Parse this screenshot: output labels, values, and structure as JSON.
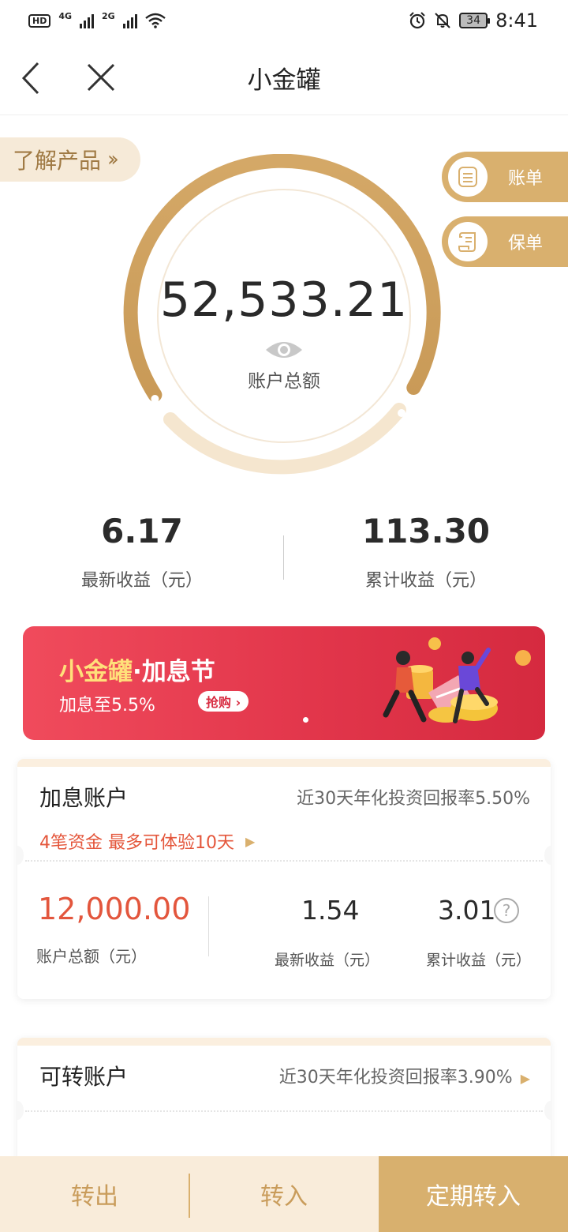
{
  "status_bar": {
    "hd": "HD",
    "net1": "4G",
    "net2": "2G",
    "battery": "34",
    "time": "8:41"
  },
  "header": {
    "title": "小金罐"
  },
  "learn_button": "了解产品",
  "side_buttons": {
    "bill": "账单",
    "policy": "保单"
  },
  "summary": {
    "total_value": "52,533.21",
    "total_label": "账户总额"
  },
  "stats": {
    "latest_value": "6.17",
    "latest_label": "最新收益（元）",
    "cumulative_value": "113.30",
    "cumulative_label": "累计收益（元）"
  },
  "banner": {
    "title_gold": "小金罐",
    "title_white": "·加息节",
    "subtitle": "加息至5.5%",
    "button": "抢购 ›"
  },
  "accounts": [
    {
      "name": "加息账户",
      "rate": "近30天年化投资回报率5.50%",
      "promo": "4笔资金 最多可体验10天",
      "total": "12,000.00",
      "total_label": "账户总额（元）",
      "latest": "1.54",
      "latest_label": "最新收益（元）",
      "cumulative": "3.01",
      "cumulative_label": "累计收益（元）",
      "help": "?"
    },
    {
      "name": "可转账户",
      "rate": "近30天年化投资回报率3.90%"
    }
  ],
  "bottom_bar": {
    "transfer_out": "转出",
    "transfer_in": "转入",
    "fixed_in": "定期转入"
  },
  "colors": {
    "gold": "#d9b06e",
    "orange_red": "#e3563d",
    "banner_red": "#e2364b"
  }
}
